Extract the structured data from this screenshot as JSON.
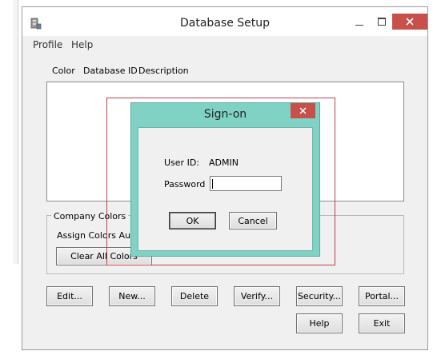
{
  "window": {
    "title": "Database Setup",
    "menu": [
      "Profile",
      "Help"
    ],
    "columns": [
      "Color",
      "Database ID",
      "Description"
    ],
    "company_colors": {
      "legend": "Company Colors",
      "assign_label": "Assign Colors Autor",
      "clear_button": "Clear All Colors"
    },
    "buttons_row1": [
      "Edit...",
      "New...",
      "Delete",
      "Verify...",
      "Security...",
      "Portal..."
    ],
    "buttons_row2": [
      "Help",
      "Exit"
    ]
  },
  "dialog": {
    "title": "Sign-on",
    "user_id_label": "User ID:",
    "user_id_value": "ADMIN",
    "password_label": "Password",
    "password_value": "",
    "ok_label": "OK",
    "cancel_label": "Cancel"
  },
  "colors": {
    "dialog_frame": "#7fd2c4",
    "close_button": "#c7504b",
    "selection_outline": "#c0404a"
  }
}
